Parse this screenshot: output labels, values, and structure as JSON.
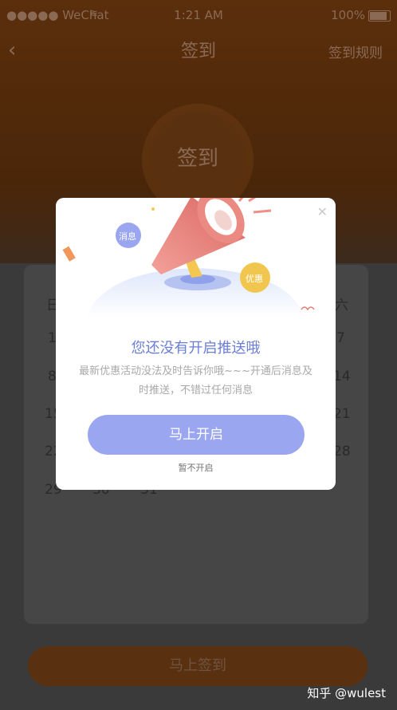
{
  "status_bar": {
    "carrier": "●●●●● WeChat",
    "time": "1:21 AM",
    "battery": "100%"
  },
  "nav": {
    "title": "签到",
    "rules": "签到规则"
  },
  "sign_circle": {
    "label": "签到"
  },
  "calendar": {
    "weekdays": [
      "日",
      "",
      "",
      "",
      "",
      "",
      "六"
    ],
    "visible_days": [
      "1",
      "7",
      "8",
      "14",
      "15",
      "21",
      "22",
      "28",
      "29",
      "30",
      "31"
    ]
  },
  "bottom_button": {
    "label": "马上签到"
  },
  "watermark": "知乎 @wulest",
  "modal": {
    "badge_message": "消息",
    "badge_discount": "优惠",
    "title": "您还没有开启推送哦",
    "description": "最新优惠活动没法及时告诉你哦~~~开通后消息及时推送，不错过任何消息",
    "enable_button": "马上开启",
    "skip_link": "暂不开启"
  },
  "colors": {
    "accent": "#9aa6ef",
    "title_blue": "#6b7ed6",
    "megaphone": "#e57b74",
    "discount_badge": "#f0c64f"
  }
}
